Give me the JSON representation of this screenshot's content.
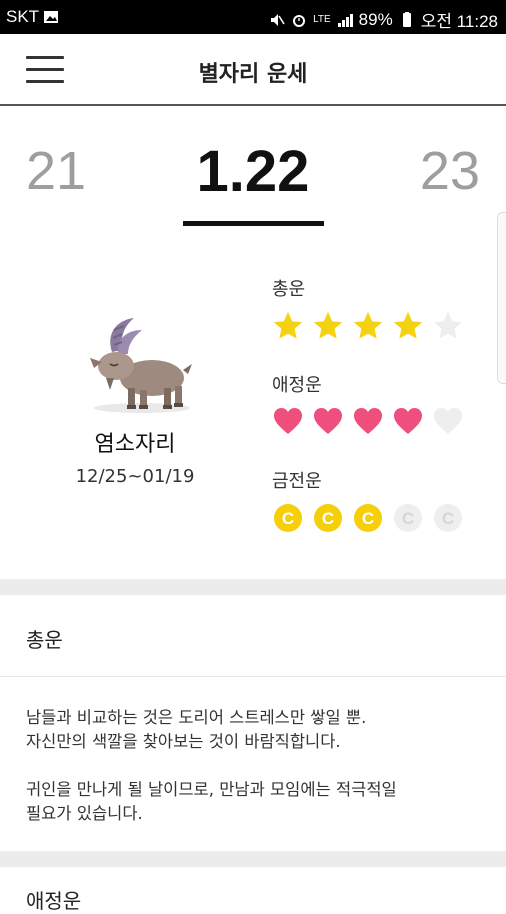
{
  "status_bar": {
    "carrier": "SKT",
    "battery": "89%",
    "time": "오전 11:28",
    "lte": "LTE"
  },
  "app_bar": {
    "title": "별자리 운세"
  },
  "date_selector": {
    "prev": "21",
    "current": "1.22",
    "next": "23"
  },
  "sign": {
    "name": "염소자리",
    "range": "12/25~01/19"
  },
  "ratings": [
    {
      "label": "총운",
      "icon": "star-icon",
      "score": 4,
      "max": 5,
      "active_color": "#f5d20f",
      "inactive_color": "#eeeeee"
    },
    {
      "label": "애정운",
      "icon": "heart-icon",
      "score": 4,
      "max": 5,
      "active_color": "#ef4f7c",
      "inactive_color": "#eeeeee"
    },
    {
      "label": "금전운",
      "icon": "coin-icon",
      "score": 3,
      "max": 5,
      "active_color": "#f5cf0a",
      "inactive_color": "#eeeeee"
    }
  ],
  "sections": [
    {
      "title": "총운",
      "body": "남들과 비교하는 것은 도리어 스트레스만 쌓일 뿐.\n자신만의 색깔을 찾아보는 것이 바람직합니다.\n\n 귀인을 만나게 될 날이므로, 만남과 모임에는 적극적일\n필요가 있습니다."
    },
    {
      "title": "애정운"
    }
  ]
}
